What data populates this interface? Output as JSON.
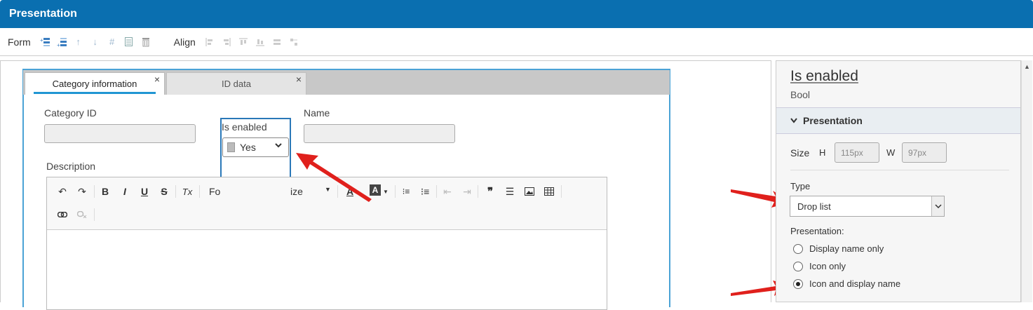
{
  "window": {
    "title": "Presentation"
  },
  "toolbar": {
    "form_label": "Form",
    "align_label": "Align"
  },
  "tabs": [
    {
      "label": "Category information",
      "close": "×"
    },
    {
      "label": "ID data",
      "close": "×"
    }
  ],
  "form": {
    "category_id_label": "Category ID",
    "is_enabled_label": "Is enabled",
    "is_enabled_value": "Yes",
    "name_label": "Name",
    "description_label": "Description"
  },
  "editor": {
    "font_label": "Fo",
    "size_label": "ize",
    "buttons": {
      "bold": "B",
      "italic": "I",
      "underline": "U",
      "strike": "S",
      "clear": "Tx",
      "text_color": "A",
      "bg_color": "A",
      "quote": "99"
    }
  },
  "panel": {
    "field_title": "Is enabled",
    "field_type": "Bool",
    "section": "Presentation",
    "size_label": "Size",
    "h_label": "H",
    "h_value": "115px",
    "w_label": "W",
    "w_value": "97px",
    "type_label": "Type",
    "type_value": "Drop list",
    "presentation_label": "Presentation:",
    "options": [
      {
        "label": "Display name only",
        "selected": false
      },
      {
        "label": "Icon only",
        "selected": false
      },
      {
        "label": "Icon and display name",
        "selected": true
      }
    ]
  },
  "colors": {
    "titlebar": "#0a6fb0",
    "accent": "#2196d3",
    "annotation_arrow": "#e0201c"
  }
}
